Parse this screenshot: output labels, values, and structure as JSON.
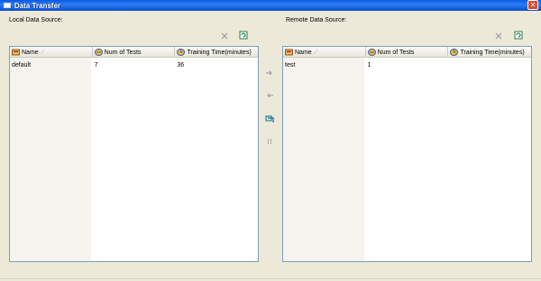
{
  "window": {
    "title": "Data Transfer",
    "close_glyph": "✕"
  },
  "local": {
    "label": "Local Data Source:",
    "columns": [
      "Name",
      "Num of Tests",
      "Training Time(minutes)"
    ],
    "rows": [
      {
        "name": "default",
        "tests": "7",
        "time": "36"
      }
    ]
  },
  "remote": {
    "label": "Remote Data Source:",
    "columns": [
      "Name",
      "Num of Tests",
      "Training Time(minutes)"
    ],
    "rows": [
      {
        "name": "test",
        "tests": "1",
        "time": ""
      }
    ]
  },
  "icons": {
    "delete": "delete-x-icon",
    "refresh": "refresh-icon",
    "move_right": "arrow-right-icon",
    "move_left": "arrow-left-icon",
    "sync": "sync-icon",
    "pause": "pause-icon"
  },
  "colors": {
    "titlebar": "#0a5adf",
    "panel": "#ece9d8",
    "grid_border": "#7f9db9"
  }
}
